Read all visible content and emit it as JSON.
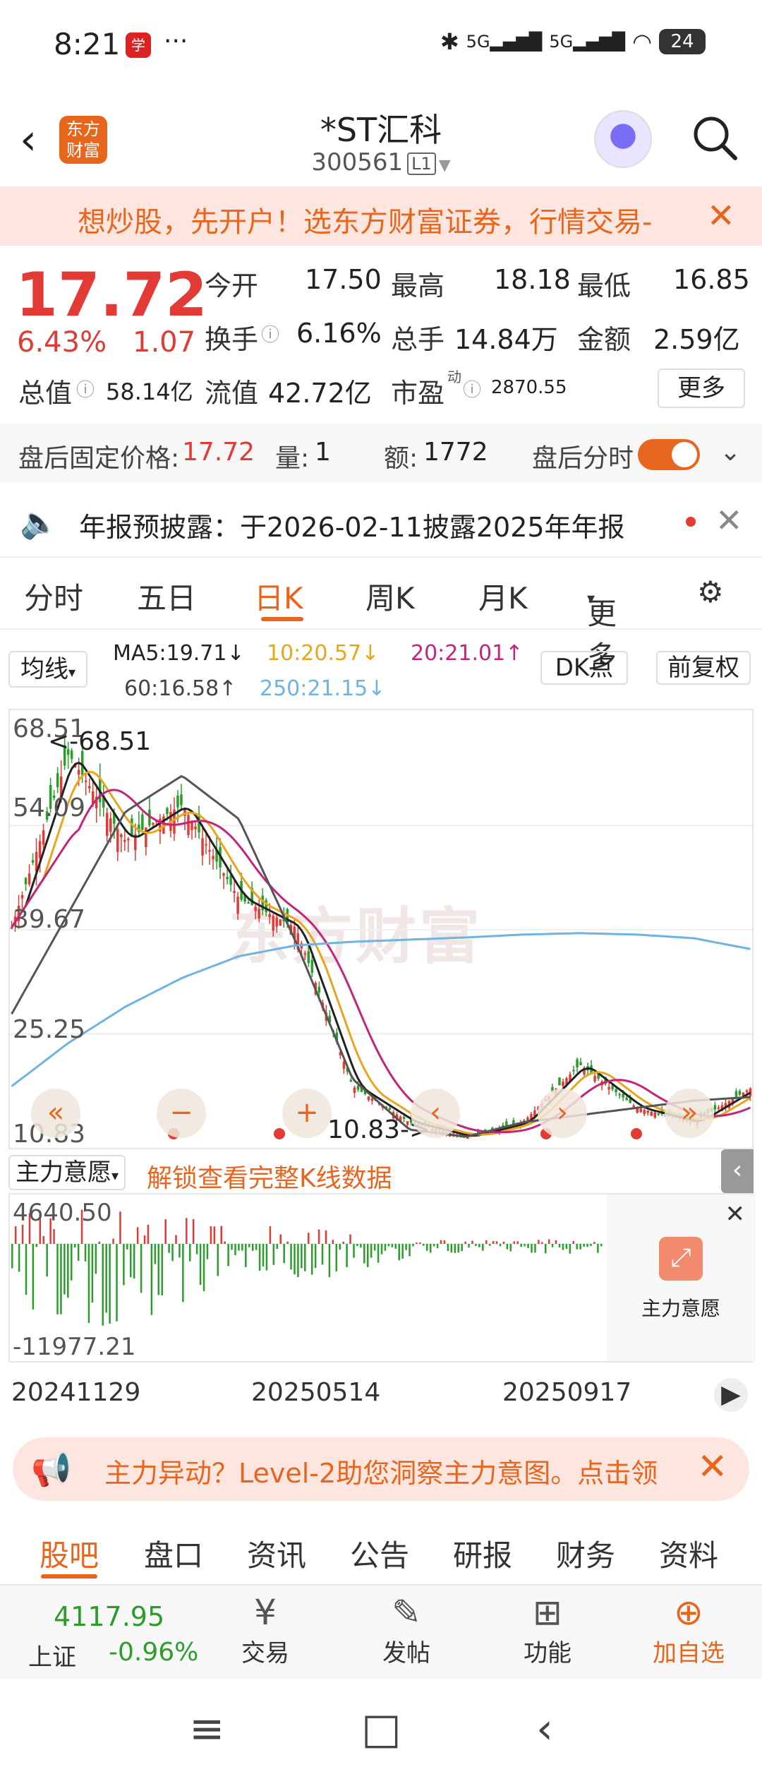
{
  "status_bar": {
    "time": "8:21",
    "app_icon_text": "学习",
    "more": "···",
    "network": "5G 5G",
    "battery": "24",
    "icons": [
      "bluetooth-icon",
      "signal-icon",
      "wifi-icon",
      "battery-icon"
    ]
  },
  "header": {
    "back": "‹",
    "logo": "东方\n财富",
    "title": "*ST汇科",
    "code": "300561",
    "code_tag": "L1"
  },
  "promo_banner": {
    "text": "想炒股，先开户！选东方财富证券，行情交易-",
    "close": "✕"
  },
  "quote": {
    "price": "17.72",
    "change_pct": "6.43%",
    "change": "1.07",
    "open_label": "今开",
    "open": "17.50",
    "high_label": "最高",
    "high": "18.18",
    "low_label": "最低",
    "low": "16.85",
    "turnover_label": "换手",
    "turnover": "6.16%",
    "volume_label": "总手",
    "volume": "14.84万",
    "amount_label": "金额",
    "amount": "2.59亿",
    "mktcap_label": "总值",
    "mktcap": "58.14亿",
    "float_label": "流值",
    "float_cap": "42.72亿",
    "pe_label": "市盈",
    "pe_sup": "动",
    "pe": "2870.55",
    "more_button": "更多"
  },
  "after_hours": {
    "price_label": "盘后固定价格:",
    "price": "17.72",
    "vol_label": "量:",
    "vol": "1",
    "amt_label": "额:",
    "amt": "1772",
    "timeshare_label": "盘后分时",
    "toggle_on": true
  },
  "notice": {
    "text": "年报预披露：于2026-02-11披露2025年年报",
    "close": "✕"
  },
  "chart_tabs": {
    "items": [
      "分时",
      "五日",
      "日K",
      "周K",
      "月K",
      "更多"
    ],
    "active": "日K"
  },
  "indicators": {
    "selector": "均线",
    "ma5": "MA5:19.71↓",
    "ma10": "10:20.57↓",
    "ma20": "20:21.01↑",
    "ma60": "60:16.58↑",
    "ma250": "250:21.15↓",
    "dk_button": "DK点",
    "fq_button": "前复权",
    "colors": {
      "ma5": "#222222",
      "ma10": "#e8a51d",
      "ma20": "#c4257a",
      "ma60": "#555555",
      "ma250": "#6fb3e0"
    }
  },
  "chart_data": {
    "type": "candlestick",
    "y_ticks": [
      "68.51",
      "54.09",
      "39.67",
      "25.25",
      "10.83"
    ],
    "watermark": "东方财富",
    "max_annotation": "<-68.51",
    "min_annotation": "10.83->",
    "x_ticks": [
      "20241129",
      "20250514",
      "20250917"
    ],
    "ylim": [
      10.83,
      68.51
    ],
    "ma250": [
      18,
      24,
      29,
      33,
      36,
      37.5,
      38,
      38.3,
      38.6,
      39,
      39.2,
      39,
      38.5,
      37
    ],
    "ma60": [
      28,
      42,
      56,
      61,
      55,
      38,
      19,
      12,
      11,
      13,
      14,
      15,
      16,
      16.5
    ],
    "close": [
      40,
      64,
      52,
      57,
      44,
      40,
      18,
      13,
      11,
      13,
      21,
      15,
      13,
      17.7
    ]
  },
  "volume_chart": {
    "selector": "主力意愿",
    "unlock_link": "解锁查看完整K线数据",
    "y_max": "4640.50",
    "y_min": "-11977.21",
    "card_label": "主力意愿",
    "card_close": "✕"
  },
  "level2_banner": {
    "text": "主力异动？Level-2助您洞察主力意图。点击领",
    "close": "✕"
  },
  "sub_tabs": {
    "items": [
      "股吧",
      "盘口",
      "资讯",
      "公告",
      "研报",
      "财务",
      "资料"
    ],
    "active": "股吧"
  },
  "bottom_bar": {
    "index_value": "4117.95",
    "index_name": "上证",
    "index_change": "-0.96%",
    "items": [
      {
        "label": "交易",
        "icon": "¥"
      },
      {
        "label": "发帖",
        "icon": "✎"
      },
      {
        "label": "功能",
        "icon": "⊞"
      },
      {
        "label": "加自选",
        "icon": "⊕"
      }
    ]
  },
  "nav_bar": {
    "menu": "≡",
    "home": "□",
    "back": "‹"
  }
}
